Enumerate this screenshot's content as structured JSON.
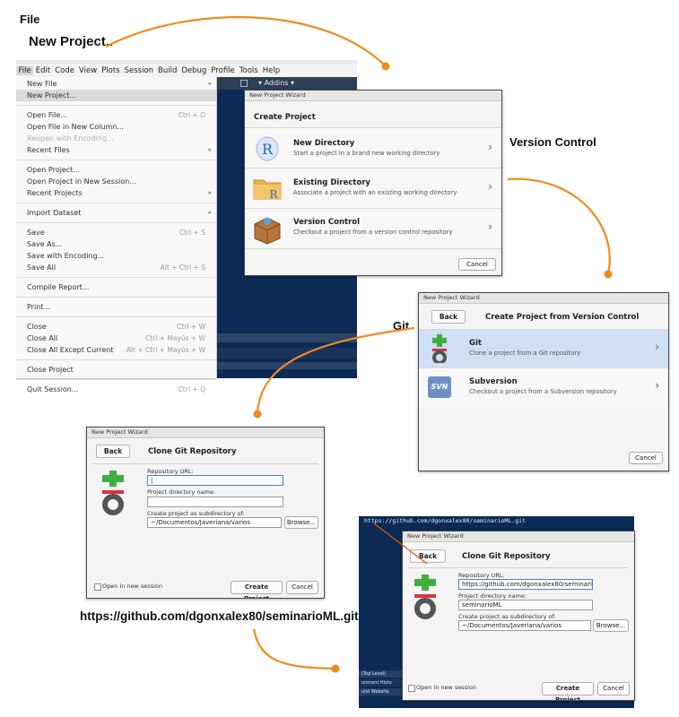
{
  "captions": {
    "file": "File",
    "new_project": "New Project..",
    "version_control": "Version Control",
    "git": "Git",
    "repo_url": "https://github.com/dgonxalex80/seminarioML.git"
  },
  "colors": {
    "arrow": "#f08a1d",
    "ide_dark": "#0b2a55",
    "selected_row": "#cfe0f5"
  },
  "menubar": [
    "File",
    "Edit",
    "Code",
    "View",
    "Plots",
    "Session",
    "Build",
    "Debug",
    "Profile",
    "Tools",
    "Help"
  ],
  "toolbar": {
    "addins": "Addins"
  },
  "file_menu": {
    "new_file": "New File",
    "new_project": "New Project...",
    "open_file": "Open File...",
    "open_file_sc": "Ctrl + O",
    "open_new_column": "Open File in New Column...",
    "reopen_encoding": "Reopen with Encoding...",
    "recent_files": "Recent Files",
    "open_project": "Open Project...",
    "open_project_session": "Open Project in New Session...",
    "recent_projects": "Recent Projects",
    "import_dataset": "Import Dataset",
    "save": "Save",
    "save_sc": "Ctrl + S",
    "save_as": "Save As...",
    "save_encoding": "Save with Encoding...",
    "save_all": "Save All",
    "save_all_sc": "Alt + Ctrl + S",
    "compile_report": "Compile Report...",
    "print": "Print...",
    "close": "Close",
    "close_sc": "Ctrl + W",
    "close_all": "Close All",
    "close_all_sc": "Ctrl + Mayús + W",
    "close_all_except": "Close All Except Current",
    "close_all_except_sc": "Alt + Ctrl + Mayús + W",
    "close_project": "Close Project",
    "quit": "Quit Session...",
    "quit_sc": "Ctrl + Q"
  },
  "wizard1": {
    "window_title": "New Project Wizard",
    "heading": "Create Project",
    "options": [
      {
        "title": "New Directory",
        "desc": "Start a project in a brand new working directory"
      },
      {
        "title": "Existing Directory",
        "desc": "Associate a project with an existing working directory"
      },
      {
        "title": "Version Control",
        "desc": "Checkout a project from a version control repository"
      }
    ],
    "cancel": "Cancel"
  },
  "wizard2": {
    "window_title": "New Project Wizard",
    "back": "Back",
    "heading": "Create Project from Version Control",
    "options": [
      {
        "title": "Git",
        "desc": "Clone a project from a Git repository"
      },
      {
        "title": "Subversion",
        "desc": "Checkout a project from a Subversion repository"
      }
    ],
    "svn_icon_text": "SVN",
    "cancel": "Cancel"
  },
  "wizard3": {
    "window_title": "New Project Wizard",
    "back": "Back",
    "heading": "Clone Git Repository",
    "repo_url_label": "Repository URL:",
    "repo_url_value": "|",
    "dir_name_label": "Project directory name:",
    "dir_name_value": "",
    "subdir_label": "Create project as subdirectory of:",
    "subdir_value": "~/Documentos/Javeriana/varios",
    "browse": "Browse...",
    "open_new_session": "Open in new session",
    "create": "Create Project",
    "cancel": "Cancel"
  },
  "wizard4": {
    "terminal_url": "https://github.com/dgonxalex80/seminarioML.git",
    "window_title": "New Project Wizard",
    "back": "Back",
    "heading": "Clone Git Repository",
    "repo_url_label": "Repository URL:",
    "repo_url_value": "https://github.com/dgonxalex80/seminarioM",
    "dir_name_label": "Project directory name:",
    "dir_name_value": "seminarioML",
    "subdir_label": "Create project as subdirectory of:",
    "subdir_value": "~/Documentos/Javeriana/varios",
    "browse": "Browse...",
    "open_new_session": "Open in new session",
    "create": "Create Project",
    "cancel": "Cancel",
    "side_labels": [
      "(Top Level)",
      "onment",
      "Histo",
      "uild Website"
    ]
  }
}
